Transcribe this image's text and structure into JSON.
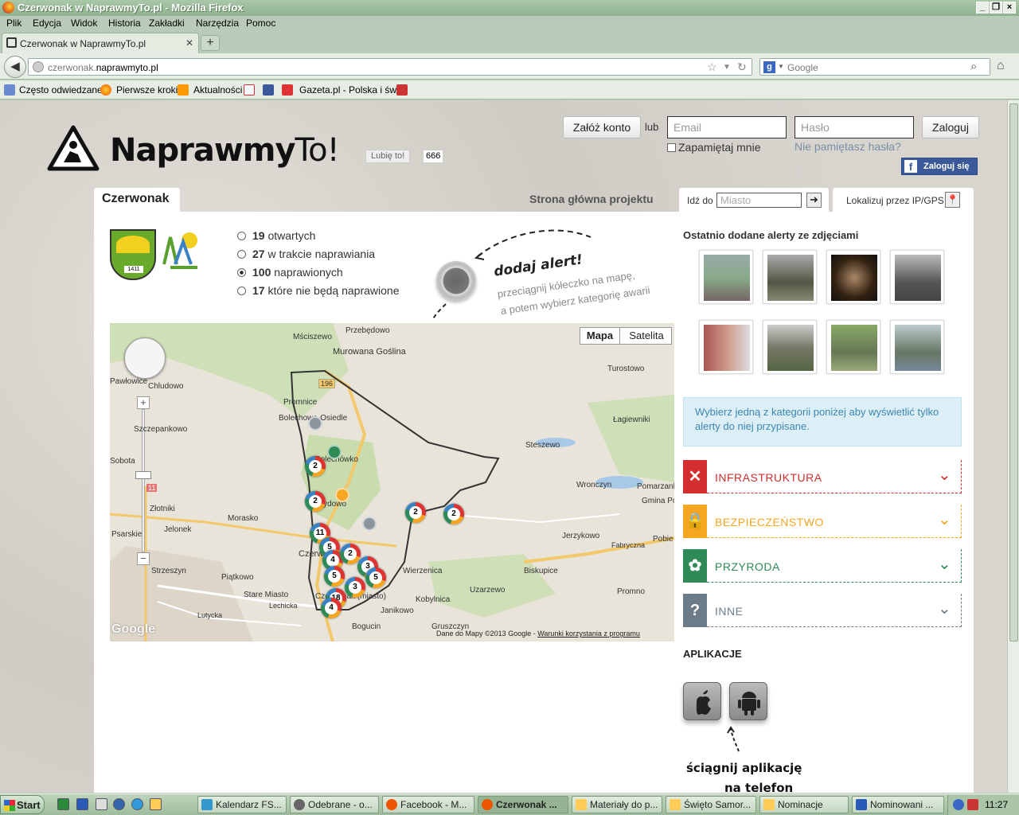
{
  "window": {
    "title": "Czerwonak w NaprawmyTo.pl - Mozilla Firefox"
  },
  "menu": [
    "Plik",
    "Edycja",
    "Widok",
    "Historia",
    "Zakładki",
    "Narzędzia",
    "Pomoc"
  ],
  "tabs": [
    {
      "label": "Czerwonak w NaprawmyTo.pl"
    }
  ],
  "newtab_label": "+",
  "address": {
    "prefix": "czerwonak.",
    "domain": "naprawmyto.pl"
  },
  "search": {
    "placeholder": "Google"
  },
  "bookmarks": [
    "Często odwiedzane",
    "Pierwsze kroki",
    "Aktualności",
    "Gazeta.pl - Polska i św..."
  ],
  "site": {
    "logo_bold": "Naprawmy",
    "logo_light": "To!",
    "like_label": "Lubię to!",
    "like_count": "666",
    "register_label": "Załóż konto",
    "or_label": "lub",
    "email_placeholder": "Email",
    "password_placeholder": "Hasło",
    "login_label": "Zaloguj",
    "remember_label": "Zapamiętaj mnie",
    "forgot_label": "Nie pamiętasz hasła?",
    "fb_login_label": "Zaloguj się",
    "city_tab": "Czerwonak",
    "home_link": "Strona główna projektu",
    "goto_label": "Idź do",
    "city_placeholder": "Miasto",
    "locate_label": "Lokalizuj przez IP/GPS"
  },
  "counts": [
    {
      "num": "19",
      "label": "otwartych",
      "selected": false
    },
    {
      "num": "27",
      "label": "w trakcie naprawiania",
      "selected": false
    },
    {
      "num": "100",
      "label": "naprawionych",
      "selected": true
    },
    {
      "num": "17",
      "label": "które nie będą naprawione",
      "selected": false
    }
  ],
  "add_alert": {
    "title": "dodaj alert!",
    "line1": "przeciągnij kółeczko na mapę,",
    "line2": "a potem wybierz kategorię awarii"
  },
  "emblem": {
    "year": "1411"
  },
  "map": {
    "type_map": "Mapa",
    "type_satellite": "Satelita",
    "copyright": "Dane do Mapy ©2013 Google - ",
    "terms": "Warunki korzystania z programu",
    "google": "Google",
    "road_label": "196",
    "road_label2": "11",
    "places": [
      "Przebędowo",
      "Mściszewo",
      "Murowana Goślina",
      "Turostowo",
      "Chludowo",
      "Promnice",
      "Bolechowo-Osiedle",
      "Łagiewniki",
      "Szczepankowo",
      "Steszewo",
      "Bolechówko",
      "Wronczyn",
      "Pomarzanki",
      "Złotniki",
      "Morasko",
      "Gmina Pobiedziska",
      "Jelonek",
      "Jerzykowo",
      "Psarskie",
      "Fabryczna",
      "Pobie",
      "Strzeszyn",
      "Wierzenica",
      "Biskupice",
      "Piątkowo",
      "Uzarzewo",
      "Stare Miasto",
      "Kobylnica",
      "Promno",
      "Lechicka",
      "Janikowo",
      "Lutycka",
      "Bogucin",
      "Gruszczyn",
      "Czerwonak",
      "Żydowo",
      "Sobota",
      "Pawłowice",
      "Czerwonak (miasto)"
    ],
    "clusters": [
      "2",
      "2",
      "2",
      "2",
      "11",
      "5",
      "4",
      "5",
      "2",
      "3",
      "5",
      "3",
      "18",
      "4"
    ]
  },
  "sidebar": {
    "photos_title": "Ostatnio dodane alerty ze zdjęciami",
    "info": "Wybierz jedną z kategorii poniżej aby wyświetlić tylko alerty do niej przypisane.",
    "categories": [
      {
        "name": "INFRASTRUKTURA",
        "color": "#d32f2f"
      },
      {
        "name": "BEZPIECZEŃSTWO",
        "color": "#f5a623"
      },
      {
        "name": "PRZYRODA",
        "color": "#2e8b57"
      },
      {
        "name": "INNE",
        "color": "#6b7b88"
      }
    ],
    "apps_title": "APLIKACJE",
    "download_line1": "ściągnij aplikację",
    "download_line2": "na telefon"
  },
  "taskbar": {
    "start": "Start",
    "items": [
      "Kalendarz FS...",
      "Odebrane - o...",
      "Facebook - M...",
      "Czerwonak ...",
      "Materiały do p...",
      "Święto Samor...",
      "Nominacje",
      "Nominowani ..."
    ],
    "clock": "11:27"
  }
}
